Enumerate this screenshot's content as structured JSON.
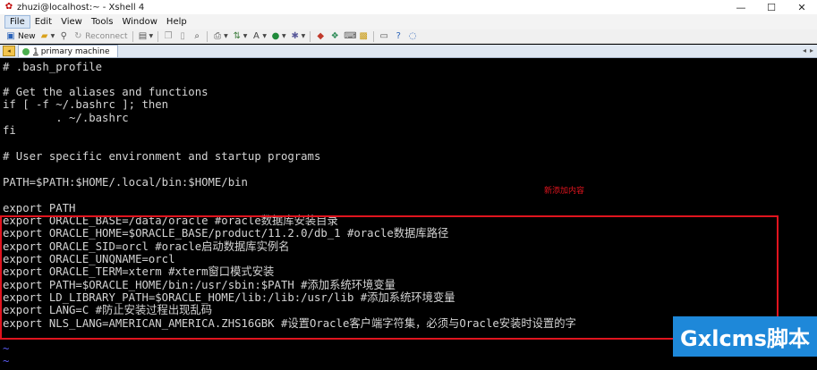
{
  "window": {
    "title": "zhuzi@localhost:~ - Xshell 4",
    "minimize_glyph": "—",
    "maximize_glyph": "☐",
    "close_glyph": "✕"
  },
  "menu": {
    "items": [
      "File",
      "Edit",
      "View",
      "Tools",
      "Window",
      "Help"
    ]
  },
  "toolbar": {
    "new_label": "New",
    "reconnect_label": "Reconnect"
  },
  "tabs": {
    "items": [
      {
        "number": "1",
        "label": "primary machine"
      }
    ]
  },
  "terminal": {
    "lines": [
      "# .bash_profile",
      "",
      "# Get the aliases and functions",
      "if [ -f ~/.bashrc ]; then",
      "        . ~/.bashrc",
      "fi",
      "",
      "# User specific environment and startup programs",
      "",
      "PATH=$PATH:$HOME/.local/bin:$HOME/bin",
      "",
      "export PATH",
      "export ORACLE_BASE=/data/oracle #oracle数据库安装目录",
      "export ORACLE_HOME=$ORACLE_BASE/product/11.2.0/db_1 #oracle数据库路径",
      "export ORACLE_SID=orcl #oracle启动数据库实例名",
      "export ORACLE_UNQNAME=orcl",
      "export ORACLE_TERM=xterm #xterm窗口模式安装",
      "export PATH=$ORACLE_HOME/bin:/usr/sbin:$PATH #添加系统环境变量",
      "export LD_LIBRARY_PATH=$ORACLE_HOME/lib:/lib:/usr/lib #添加系统环境变量",
      "export LANG=C #防止安装过程出现乱码",
      "export NLS_LANG=AMERICAN_AMERICA.ZHS16GBK #设置Oracle客户端字符集，必须与Oracle安装时设置的字",
      "~",
      "~"
    ],
    "annotation": "新添加内容",
    "highlight_color": "#e0141e"
  },
  "watermark": {
    "text": "Gxlcms脚本",
    "color": "#1e88d9"
  }
}
